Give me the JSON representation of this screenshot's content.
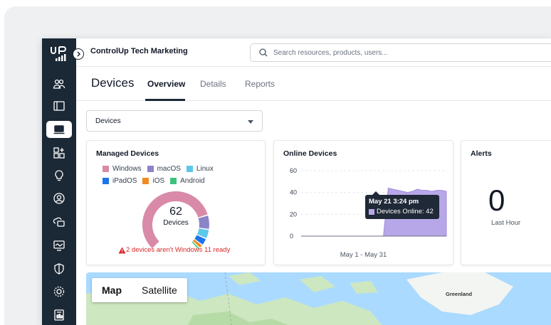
{
  "header": {
    "org_name": "ControlUp Tech Marketing",
    "search_placeholder": "Search resources, products, users..."
  },
  "page": {
    "title": "Devices",
    "tabs": [
      {
        "label": "Overview",
        "active": true
      },
      {
        "label": "Details",
        "active": false
      },
      {
        "label": "Reports",
        "active": false
      }
    ]
  },
  "filter": {
    "selected": "Devices"
  },
  "sidebar": {
    "icons": [
      "users-icon",
      "dashboard-icon",
      "devices-icon",
      "apps-icon",
      "lightbulb-icon",
      "user-circle-icon",
      "cloud-icon",
      "monitor-icon",
      "shield-icon",
      "gear-icon",
      "report-icon"
    ],
    "active": "devices-icon"
  },
  "managed_devices": {
    "title": "Managed Devices",
    "legend": [
      {
        "label": "Windows",
        "color": "#d98aa8"
      },
      {
        "label": "macOS",
        "color": "#8b84c8"
      },
      {
        "label": "Linux",
        "color": "#5cc8ea"
      },
      {
        "label": "iPadOS",
        "color": "#1d74e8"
      },
      {
        "label": "iOS",
        "color": "#f08a24"
      },
      {
        "label": "Android",
        "color": "#3ec27a"
      }
    ],
    "total": "62",
    "total_label": "Devices",
    "warning": "2 devices aren't Windows 11 ready"
  },
  "online_devices": {
    "title": "Online Devices",
    "date_range": "May 1 - May 31",
    "tooltip": {
      "date": "May 21 3:24 pm",
      "label": "Devices Online: 42"
    }
  },
  "alerts": {
    "title": "Alerts",
    "value": "0",
    "period": "Last Hour"
  },
  "map": {
    "modes": [
      "Map",
      "Satellite"
    ],
    "active_mode": "Map",
    "label": "Greenland"
  },
  "chart_data": {
    "type": "area",
    "y_ticks": [
      "0",
      "20",
      "40",
      "60"
    ],
    "ylim": [
      0,
      60
    ],
    "x": [
      1,
      2,
      3,
      4,
      5,
      6,
      7,
      8,
      9,
      10,
      11,
      12,
      13,
      14,
      15,
      16,
      17,
      18,
      19,
      20,
      21,
      22,
      23,
      24,
      25,
      26,
      27,
      28,
      29,
      30,
      31
    ],
    "series": [
      {
        "values": [
          0,
          0,
          0,
          0,
          0,
          0,
          0,
          0,
          0,
          0,
          0,
          0,
          0,
          0,
          0,
          0,
          0,
          0,
          44,
          43,
          42,
          41,
          40,
          41,
          43,
          42,
          42,
          41,
          42,
          42,
          41
        ],
        "color": "#b8a7e8"
      }
    ]
  }
}
